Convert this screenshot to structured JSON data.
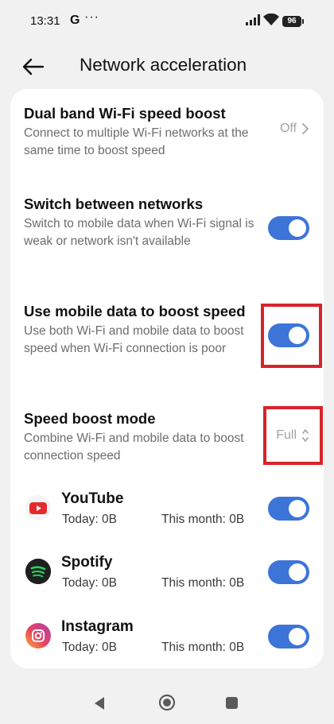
{
  "status_bar": {
    "time": "13:31",
    "g_label": "G",
    "dots": "···",
    "battery": "96",
    "icons": [
      "signal-icon",
      "wifi-icon",
      "battery-icon"
    ]
  },
  "header": {
    "title": "Network acceleration",
    "back_icon": "back-arrow-icon"
  },
  "settings": {
    "dual_band": {
      "title": "Dual band Wi-Fi speed boost",
      "desc": "Connect to multiple Wi-Fi networks at the same time to boost speed",
      "value": "Off"
    },
    "switch_networks": {
      "title": "Switch between networks",
      "desc": "Switch to mobile data when Wi-Fi signal is weak or network isn't available",
      "enabled": true
    },
    "mobile_boost": {
      "title": "Use mobile data to boost speed",
      "desc": "Use both Wi-Fi and mobile data to boost speed when Wi-Fi connection is poor",
      "enabled": true
    },
    "boost_mode": {
      "title": "Speed boost mode",
      "desc": "Combine Wi-Fi and mobile data to boost connection speed",
      "value": "Full"
    }
  },
  "apps": [
    {
      "name": "YouTube",
      "today": "Today: 0B",
      "month": "This month: 0B",
      "enabled": true,
      "icon": "youtube-icon"
    },
    {
      "name": "Spotify",
      "today": "Today: 0B",
      "month": "This month: 0B",
      "enabled": true,
      "icon": "spotify-icon"
    },
    {
      "name": "Instagram",
      "today": "Today: 0B",
      "month": "This month: 0B",
      "enabled": true,
      "icon": "instagram-icon"
    }
  ],
  "colors": {
    "accent": "#3d74d8",
    "highlight": "#d8232a",
    "background": "#f1f1f1",
    "card": "#ffffff"
  },
  "nav": {
    "icons": [
      "nav-back-icon",
      "nav-home-icon",
      "nav-recents-icon"
    ]
  }
}
